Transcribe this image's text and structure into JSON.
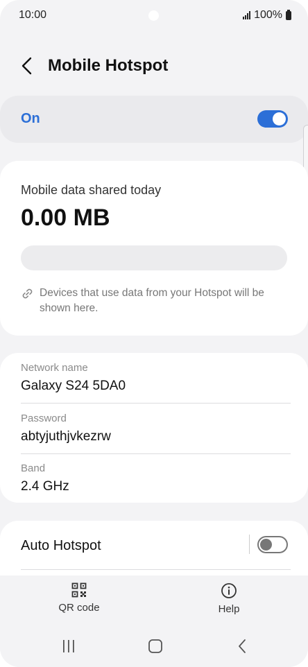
{
  "status_bar": {
    "time": "10:00",
    "battery": "100%"
  },
  "header": {
    "title": "Mobile Hotspot"
  },
  "hotspot": {
    "state_label": "On",
    "enabled": true
  },
  "data_usage": {
    "label": "Mobile data shared today",
    "value": "0.00 MB",
    "usage_fraction": 0,
    "info": "Devices that use data from your Hotspot will be shown here."
  },
  "network": {
    "name_label": "Network name",
    "name_value": "Galaxy S24 5DA0",
    "password_label": "Password",
    "password_value": "abtyjuthjvkezrw",
    "band_label": "Band",
    "band_value": "2.4 GHz"
  },
  "auto_hotspot": {
    "label": "Auto Hotspot",
    "enabled": false
  },
  "actions": {
    "qr_label": "QR code",
    "help_label": "Help"
  },
  "icons": {
    "back": "back-arrow-icon",
    "link": "link-icon",
    "qr": "qr-code-icon",
    "help": "info-icon",
    "recents": "recents-icon",
    "home": "home-icon",
    "nav_back": "chevron-left-icon"
  },
  "colors": {
    "accent": "#2c6fd7",
    "background": "#f3f3f5",
    "card": "#ffffff"
  }
}
